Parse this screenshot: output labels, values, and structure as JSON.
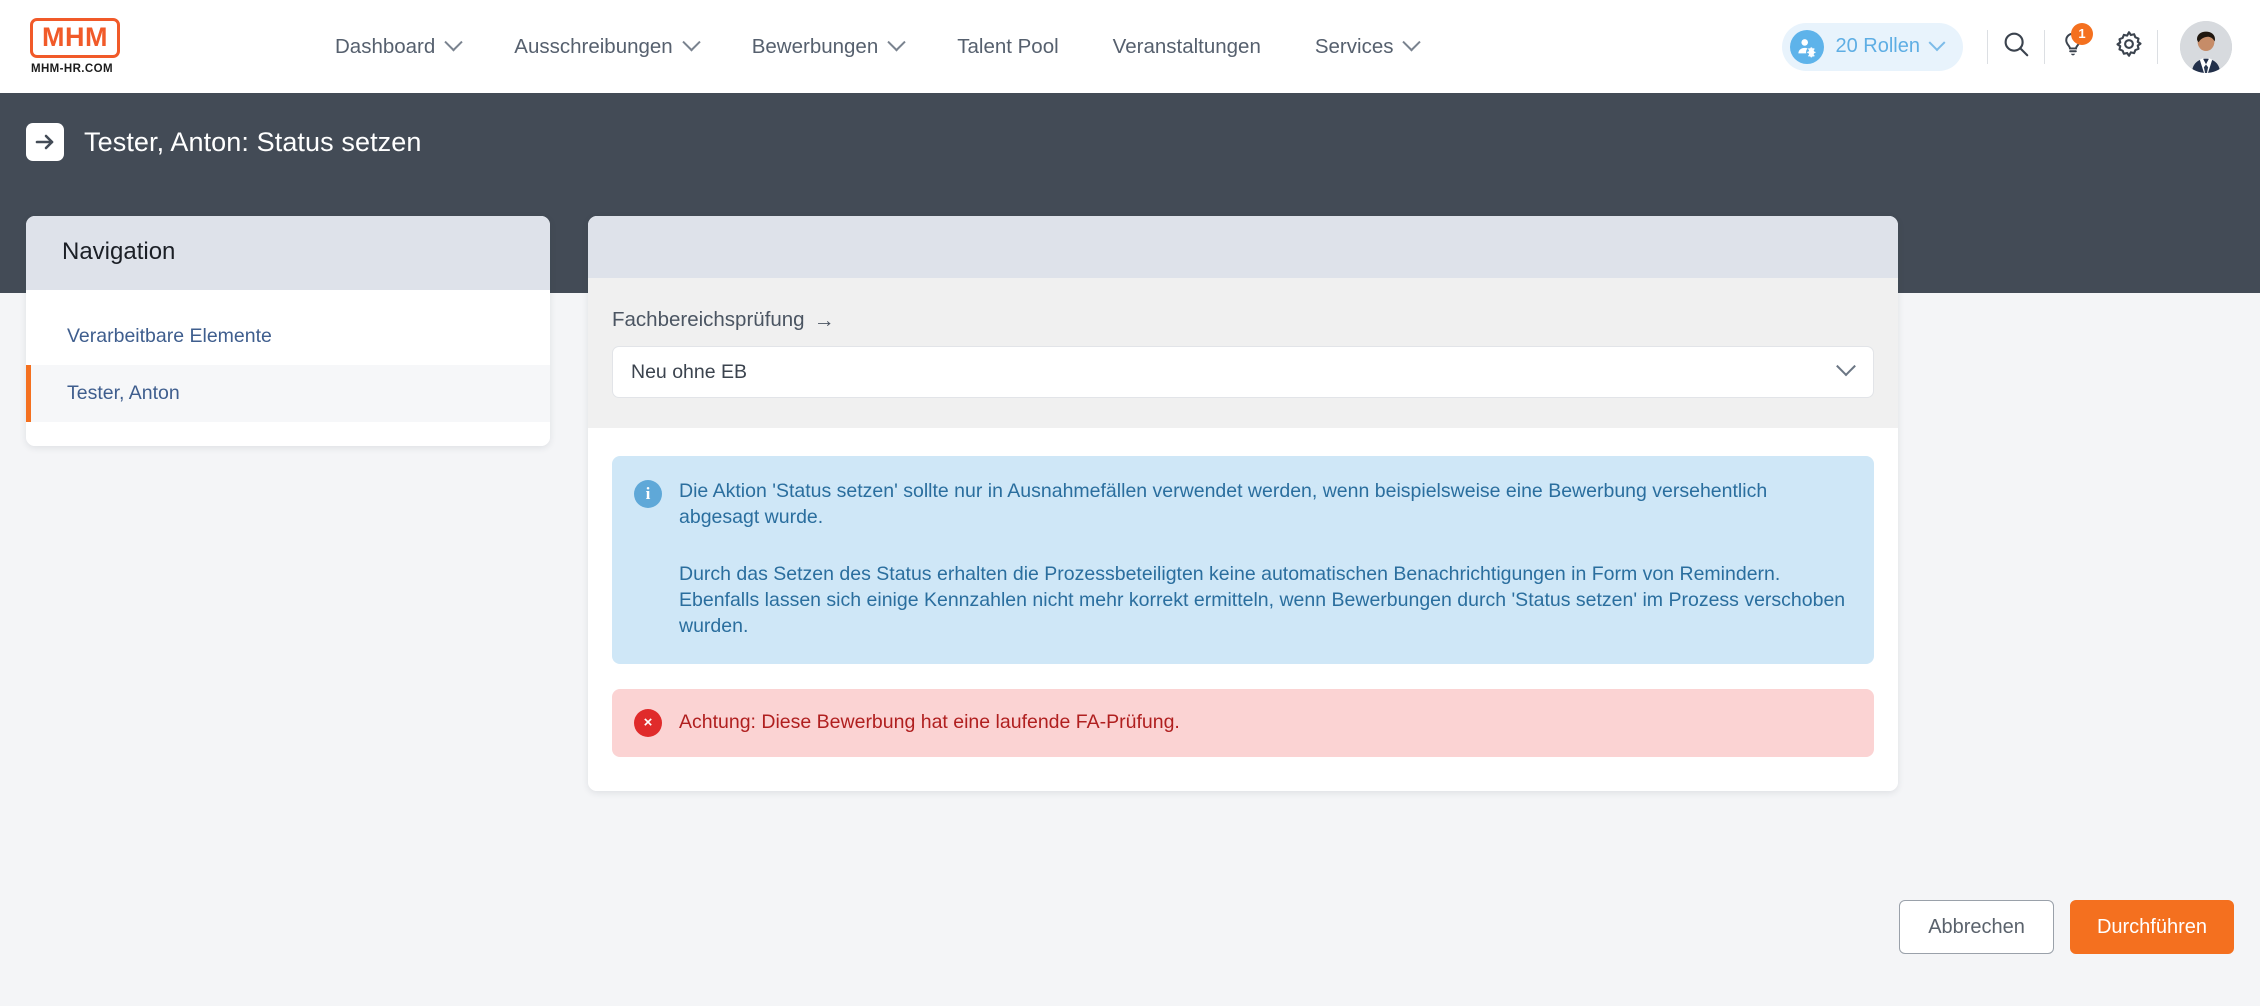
{
  "brand": {
    "logo_text": "MHM",
    "sub_text": "MHM-HR.COM"
  },
  "topnav": {
    "items": [
      {
        "label": "Dashboard",
        "has_dropdown": true
      },
      {
        "label": "Ausschreibungen",
        "has_dropdown": true
      },
      {
        "label": "Bewerbungen",
        "has_dropdown": true
      },
      {
        "label": "Talent Pool",
        "has_dropdown": false
      },
      {
        "label": "Veranstaltungen",
        "has_dropdown": false
      },
      {
        "label": "Services",
        "has_dropdown": true
      }
    ]
  },
  "topright": {
    "roles_label": "20 Rollen",
    "roles_icon": "user-gear-icon",
    "search_icon": "search-icon",
    "tips_icon": "lightbulb-icon",
    "tips_badge": "1",
    "settings_icon": "gear-icon",
    "avatar_icon": "user-avatar"
  },
  "page": {
    "title_icon": "arrow-right-box-icon",
    "title": "Tester, Anton: Status setzen"
  },
  "navigation_card": {
    "title": "Navigation",
    "items": [
      {
        "label": "Verarbeitbare Elemente",
        "active": false
      },
      {
        "label": "Tester, Anton",
        "active": true
      }
    ]
  },
  "form": {
    "field_label": "Fachbereichsprüfung",
    "field_label_arrow": "→",
    "select_value": "Neu ohne EB",
    "select_chevron_icon": "chevron-down-icon"
  },
  "alerts": {
    "info": {
      "icon": "info-circle-icon",
      "icon_glyph": "i",
      "paragraphs": [
        "Die Aktion 'Status setzen' sollte nur in Ausnahmefällen verwendet werden, wenn beispielsweise eine Bewerbung versehentlich abgesagt wurde.",
        "Durch das Setzen des Status erhalten die Prozessbeteiligten keine automatischen Benachrichtigungen in Form von Remindern. Ebenfalls lassen sich einige Kennzahlen nicht mehr korrekt ermitteln, wenn Bewerbungen durch 'Status setzen' im Prozess verschoben wurden."
      ]
    },
    "error": {
      "icon": "error-circle-icon",
      "icon_glyph": "×",
      "text": "Achtung: Diese Bewerbung hat eine laufende FA-Prüfung."
    }
  },
  "footer": {
    "cancel_label": "Abbrechen",
    "submit_label": "Durchführen"
  },
  "colors": {
    "brand_orange": "#f4701f",
    "logo_orange": "#f15a29",
    "dark_header": "#434b56",
    "card_header": "#dee2ea",
    "link_blue": "#3f5e8e",
    "info_bg": "#cfe7f7",
    "info_text": "#2a6e9e",
    "error_bg": "#fbd3d3",
    "error_text": "#b01f1f",
    "error_icon": "#e02b2b",
    "roles_pill_bg": "#e8f3fc",
    "roles_pill_text": "#5eaee4",
    "page_bg": "#f4f5f7"
  }
}
